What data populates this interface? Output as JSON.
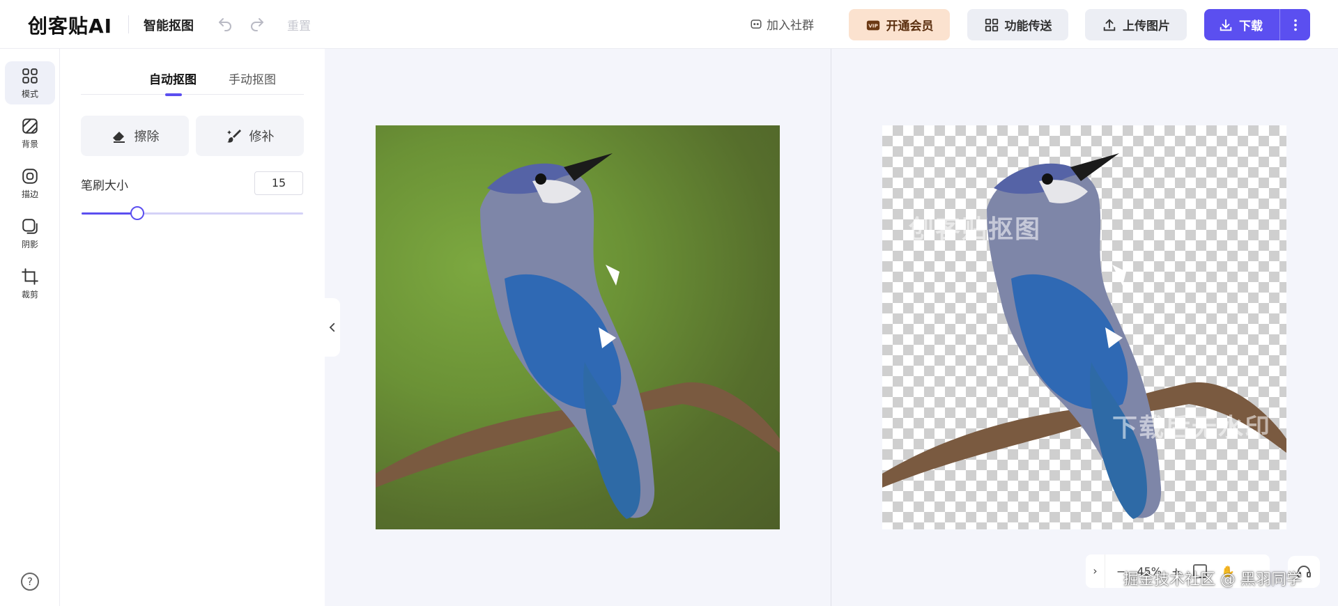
{
  "header": {
    "logo": "创客贴AI",
    "app_title": "智能抠图",
    "reset": "重置",
    "join_community": "加入社群",
    "vip": "开通会员",
    "transfer": "功能传送",
    "upload": "上传图片",
    "download": "下载"
  },
  "rail": {
    "items": [
      {
        "label": "模式",
        "icon": "grid-icon"
      },
      {
        "label": "背景",
        "icon": "background-hatch-icon"
      },
      {
        "label": "描边",
        "icon": "stroke-icon"
      },
      {
        "label": "阴影",
        "icon": "shadow-icon"
      },
      {
        "label": "裁剪",
        "icon": "crop-icon"
      }
    ],
    "help": "?"
  },
  "panel": {
    "tabs": [
      "自动抠图",
      "手动抠图"
    ],
    "erase": "擦除",
    "repair": "修补",
    "brush_label": "笔刷大小",
    "brush_value": "15",
    "brush_fraction": 0.25
  },
  "canvas": {
    "watermark_top": "创客贴抠图",
    "watermark_bottom": "下载后无水印"
  },
  "zoom": {
    "minus": "−",
    "value": "45%",
    "plus": "+"
  },
  "footer_watermark": "掘金技术社区 @ 黑羽同学",
  "colors": {
    "accent": "#5b4ff0",
    "vip_bg": "#fbe2cf"
  }
}
